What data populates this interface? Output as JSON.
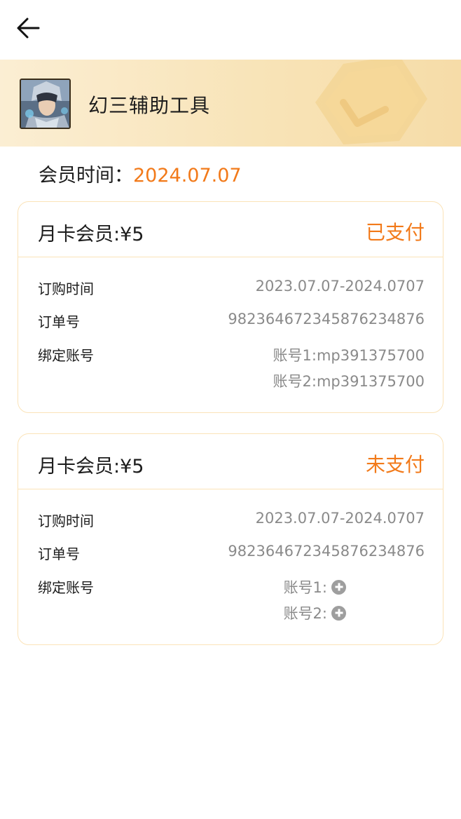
{
  "header": {
    "back_icon": "arrow-left-icon"
  },
  "banner": {
    "app_name": "幻三辅助工具",
    "avatar_icon": "game-character-avatar",
    "decoration_icon": "hexagon-checkmark-icon"
  },
  "membership": {
    "label": "会员时间：",
    "date": "2024.07.07"
  },
  "labels": {
    "order_time": "订购时间",
    "order_no": "订单号",
    "bound_accounts": "绑定账号"
  },
  "orders": [
    {
      "title": "月卡会员:¥5",
      "status": "已支付",
      "order_time": "2023.07.07-2024.0707",
      "order_no": "98236467234587623487​6",
      "account1": "账号1:mp391375700",
      "account2": "账号2:mp391375700"
    },
    {
      "title": "月卡会员:¥5",
      "status": "未支付",
      "order_time": "2023.07.07-2024.0707",
      "order_no": "98236467234587623487​6",
      "account1": "账号1:",
      "account2": "账号2:"
    }
  ],
  "colors": {
    "accent": "#f27a1a",
    "border": "#fbe3b8",
    "banner": "#f8e3b6"
  }
}
